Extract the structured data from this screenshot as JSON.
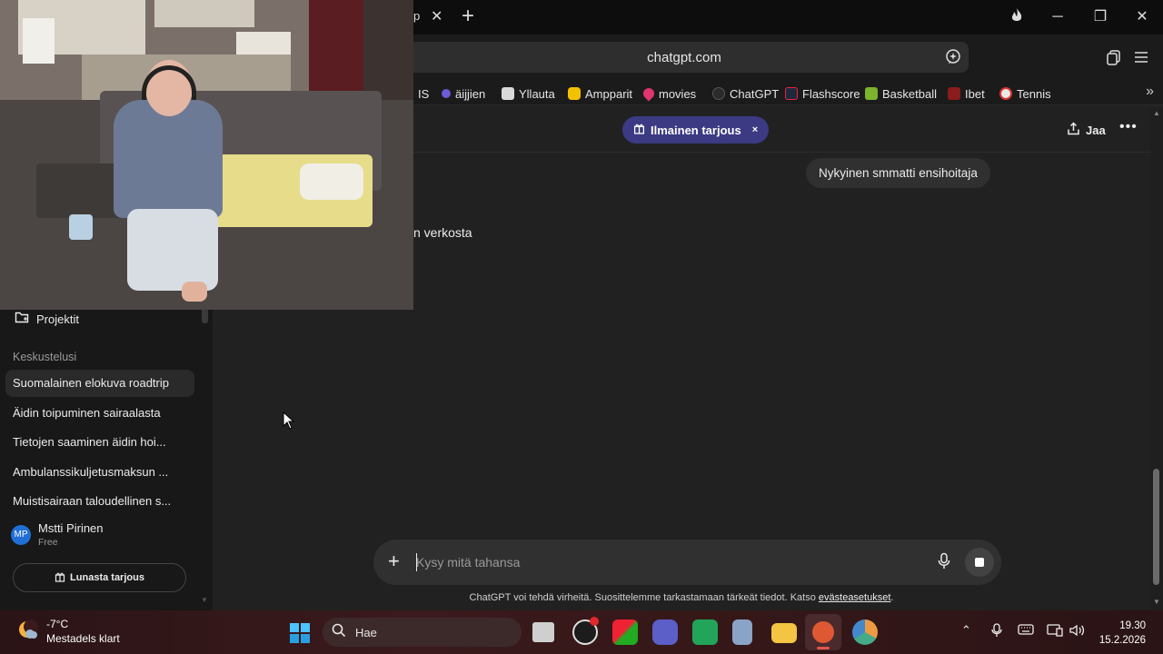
{
  "browser": {
    "tab_fragment": "p",
    "url": "chatgpt.com",
    "bookmarks": [
      {
        "label": "IS",
        "color": "#1b1b1b"
      },
      {
        "label": "äijjien",
        "color": "#6b5bd6"
      },
      {
        "label": "Yllauta",
        "color": "#d9d9d9"
      },
      {
        "label": "Ampparit",
        "color": "#f2c200"
      },
      {
        "label": "movies",
        "color": "#e0356f"
      },
      {
        "label": "ChatGPT",
        "color": "#2b2b2b"
      },
      {
        "label": "Flashscore",
        "color": "#1c2a3a"
      },
      {
        "label": "Basketball",
        "color": "#7bb32e"
      },
      {
        "label": "Ibet",
        "color": "#8a1c1c"
      },
      {
        "label": "Tennis",
        "color": "#e8e8e8"
      }
    ]
  },
  "sidebar": {
    "projects_label": "Projektit",
    "chats_heading": "Keskustelusi",
    "chats": [
      "Suomalainen elokuva roadtrip",
      "Äidin toipuminen sairaalasta",
      "Tietojen saaminen äidin hoi...",
      "Ambulanssikuljetusmaksun ...",
      "Muistisairaan taloudellinen s..."
    ],
    "user": {
      "initials": "MP",
      "name": "Mstti Pirinen",
      "plan": "Free"
    },
    "upgrade_label": "Lunasta tarjous"
  },
  "header": {
    "promo_label": "Ilmainen tarjous",
    "promo_close": "×",
    "share_label": "Jaa",
    "more_label": "•••"
  },
  "conversation": {
    "user_message": "Nykyinen smmatti ensihoitaja",
    "assistant_fragment": "n verkosta"
  },
  "composer": {
    "placeholder": "Kysy mitä tahansa"
  },
  "disclaimer": {
    "text": "ChatGPT voi tehdä virheitä. Suosittelemme tarkastamaan tärkeät tiedot. Katso ",
    "link": "evästeasetukset",
    "end": "."
  },
  "taskbar": {
    "weather_temp": "-7°C",
    "weather_desc": "Mestadels klart",
    "search_label": "Hae",
    "time": "19.30",
    "date": "15.2.2026"
  },
  "colors": {
    "promo_bg": "#3b3a82",
    "sidebar_bg": "#181818",
    "main_bg": "#212121",
    "avatar_bg": "#1f6fd6"
  }
}
